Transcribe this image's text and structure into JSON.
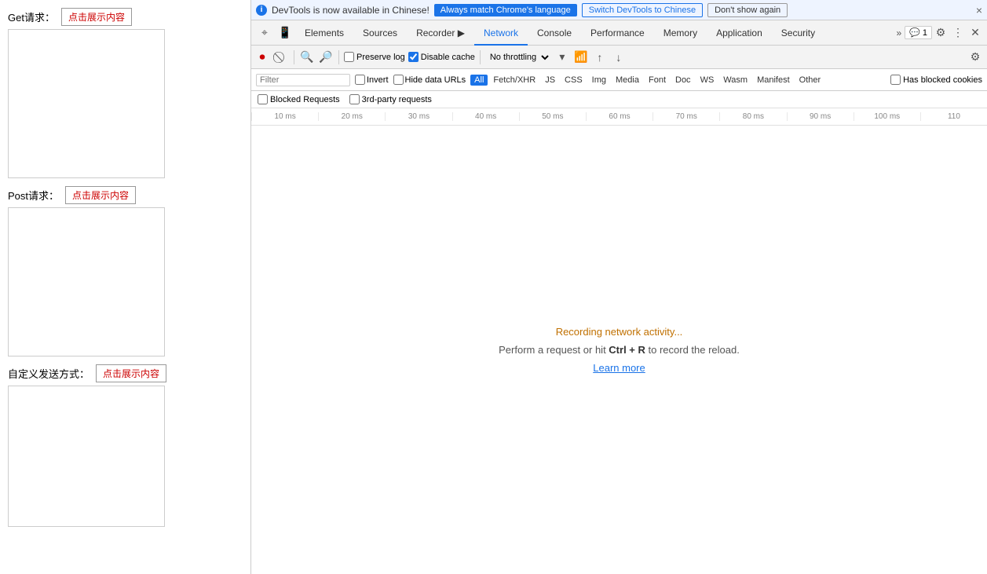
{
  "left": {
    "get_label": "Get请求：",
    "get_btn": "点击展示内容",
    "post_label": "Post请求：",
    "post_btn": "点击展示内容",
    "custom_label": "自定义发送方式：",
    "custom_btn": "点击展示内容"
  },
  "infobar": {
    "icon": "i",
    "message": "DevTools is now available in Chinese!",
    "btn_match": "Always match Chrome's language",
    "btn_switch": "Switch DevTools to Chinese",
    "btn_no_show": "Don't show again",
    "close": "×"
  },
  "tabs": [
    {
      "label": "Elements",
      "active": false
    },
    {
      "label": "Sources",
      "active": false
    },
    {
      "label": "Recorder ▶",
      "active": false
    },
    {
      "label": "Network",
      "active": true
    },
    {
      "label": "Console",
      "active": false
    },
    {
      "label": "Performance",
      "active": false
    },
    {
      "label": "Memory",
      "active": false
    },
    {
      "label": "Application",
      "active": false
    },
    {
      "label": "Security",
      "active": false
    }
  ],
  "toolbar": {
    "preserve_log": "Preserve log",
    "disable_cache": "Disable cache",
    "throttle": "No throttling",
    "comment_count": "1"
  },
  "filter_bar": {
    "invert": "Invert",
    "hide_data_urls": "Hide data URLs",
    "tags": [
      "All",
      "Fetch/XHR",
      "JS",
      "CSS",
      "Img",
      "Media",
      "Font",
      "Doc",
      "WS",
      "Wasm",
      "Manifest",
      "Other"
    ],
    "active_tag": "All",
    "has_blocked": "Has blocked cookies",
    "blocked_requests": "Blocked Requests",
    "third_party": "3rd-party requests"
  },
  "timeline": {
    "ticks": [
      "10 ms",
      "20 ms",
      "30 ms",
      "40 ms",
      "50 ms",
      "60 ms",
      "70 ms",
      "80 ms",
      "90 ms",
      "100 ms",
      "110"
    ]
  },
  "network_empty": {
    "recording": "Recording network activity...",
    "perform": "Perform a request or hit Ctrl + R to record the reload.",
    "learn_more": "Learn more"
  }
}
